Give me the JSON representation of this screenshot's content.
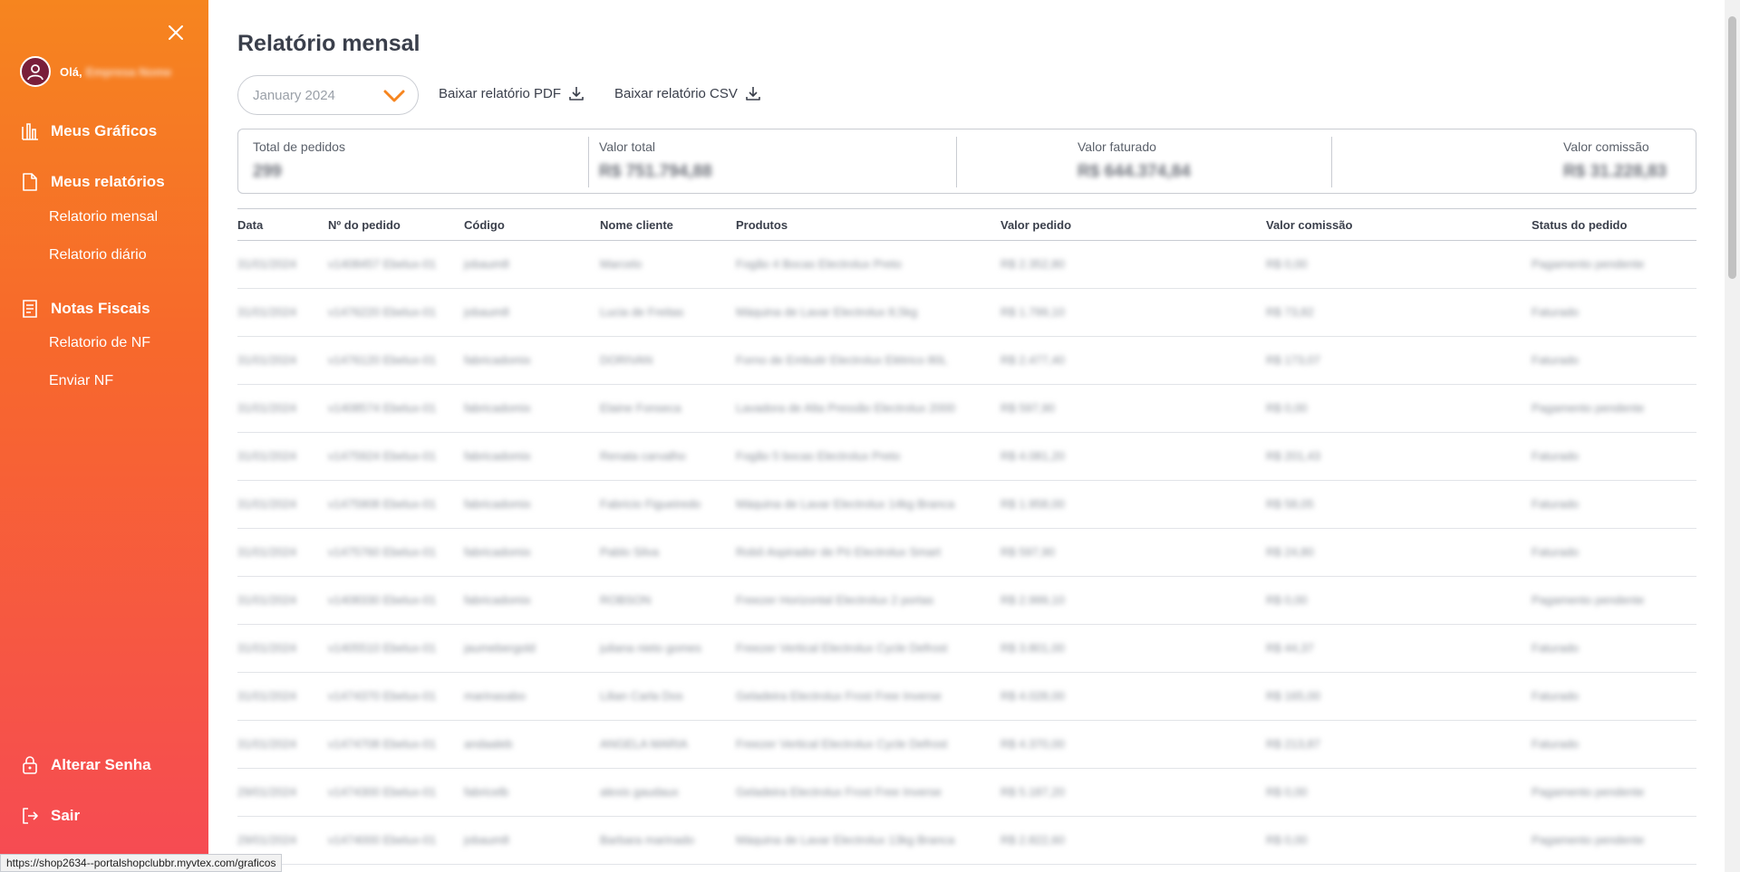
{
  "sidebar": {
    "greeting": "Olá,",
    "user_name": "Empresa Nome",
    "sections": [
      {
        "label": "Meus Gráficos",
        "icon": "bar-chart-icon"
      },
      {
        "label": "Meus relatórios",
        "icon": "document-icon"
      },
      {
        "label": "Notas Fiscais",
        "icon": "invoice-icon"
      }
    ],
    "sub_items": {
      "relatorio_mensal": "Relatorio mensal",
      "relatorio_diario": "Relatorio diário",
      "relatorio_nf": "Relatorio de NF",
      "enviar_nf": "Enviar NF"
    },
    "bottom": [
      {
        "label": "Alterar Senha",
        "icon": "lock-icon"
      },
      {
        "label": "Sair",
        "icon": "logout-icon"
      }
    ]
  },
  "main": {
    "title": "Relatório mensal",
    "month_select": {
      "value": "January 2024"
    },
    "download_pdf": "Baixar relatório PDF",
    "download_csv": "Baixar relatório CSV",
    "summary": {
      "total_pedidos": {
        "label": "Total de pedidos",
        "value": "299"
      },
      "valor_total": {
        "label": "Valor total",
        "value": "R$ 751.794,88"
      },
      "valor_faturado": {
        "label": "Valor faturado",
        "value": "R$ 644.374,84"
      },
      "valor_comissao": {
        "label": "Valor comissão",
        "value": "R$ 31.228,83"
      }
    },
    "table": {
      "headers": [
        "Data",
        "Nº do pedido",
        "Código",
        "Nome cliente",
        "Produtos",
        "Valor pedido",
        "Valor comissão",
        "Status do pedido"
      ],
      "rows": [
        [
          "31/01/2024",
          "v1408457 Ebelux-01",
          "jobaum8",
          "Marcelo",
          "Fogão 4 Bocas Electrolux Preto",
          "R$ 2.352,80",
          "R$ 0,00",
          "Pagamento pendente"
        ],
        [
          "31/01/2024",
          "v1476220 Ebelux-01",
          "jobaum8",
          "Lucia de Freitas",
          "Máquina de Lavar Electrolux 8,5kg",
          "R$ 1.799,10",
          "R$ 73,82",
          "Faturado"
        ],
        [
          "31/01/2024",
          "v1476120 Ebelux-01",
          "fabricadomix",
          "DORIVAN",
          "Forno de Embutir Electrolux Elétrico 80L",
          "R$ 2.477,40",
          "R$ 173,07",
          "Faturado"
        ],
        [
          "31/01/2024",
          "v1408574 Ebelux-01",
          "fabricadomix",
          "Elaine Fonseca",
          "Lavadora de Alta Pressão Electrolux 2000",
          "R$ 597,90",
          "R$ 0,00",
          "Pagamento pendente"
        ],
        [
          "31/01/2024",
          "v1475924 Ebelux-01",
          "fabricadomix",
          "Renata carvalho",
          "Fogão 5 bocas Electrolux Preto",
          "R$ 4.081,20",
          "R$ 201,43",
          "Faturado"
        ],
        [
          "31/01/2024",
          "v1475908 Ebelux-01",
          "fabricadomix",
          "Fabricio Figueiredo",
          "Máquina de Lavar Electrolux 14kg Branca",
          "R$ 1.958,00",
          "R$ 58,05",
          "Faturado"
        ],
        [
          "31/01/2024",
          "v1475760 Ebelux-01",
          "fabricadomix",
          "Pablo Silva",
          "Robô Aspirador de Pó Electrolux Smart",
          "R$ 597,90",
          "R$ 24,80",
          "Faturado"
        ],
        [
          "31/01/2024",
          "v1408330 Ebelux-01",
          "fabricadomix",
          "ROBSON",
          "Freezer Horizontal Electrolux 2 portas",
          "R$ 2.999,10",
          "R$ 0,00",
          "Pagamento pendente"
        ],
        [
          "31/01/2024",
          "v1405510 Ebelux-01",
          "jaumebergold",
          "juliana nieto gomes",
          "Freezer Vertical Electrolux Cycle Defrost",
          "R$ 3.801,00",
          "R$ 44,37",
          "Faturado"
        ],
        [
          "31/01/2024",
          "v1474370 Ebelux-01",
          "marinasabo",
          "Lilian Carla Dos",
          "Geladeira Electrolux Frost Free Inverse",
          "R$ 4.028,00",
          "R$ 165,00",
          "Faturado"
        ],
        [
          "31/01/2024",
          "v1474708 Ebelux-01",
          "andaaleb",
          "ANGELA MARIA",
          "Freezer Vertical Electrolux Cycle Defrost",
          "R$ 4.370,00",
          "R$ 213,87",
          "Faturado"
        ],
        [
          "29/01/2024",
          "v1474300 Ebelux-01",
          "fabricelb",
          "alexis gaudaux",
          "Geladeira Electrolux Frost Free Inverse",
          "R$ 5.187,20",
          "R$ 0,00",
          "Pagamento pendente"
        ],
        [
          "29/01/2024",
          "v1474000 Ebelux-01",
          "jobaum8",
          "Barbara marinado",
          "Máquina de Lavar Electrolux 13kg Branca",
          "R$ 2.822,60",
          "R$ 0,00",
          "Pagamento pendente"
        ]
      ]
    }
  },
  "status_url": "https://shop2634--portalshopclubbr.myvtex.com/graficos",
  "colors": {
    "accent": "#f6851f",
    "gradient_end": "#f64a54"
  }
}
